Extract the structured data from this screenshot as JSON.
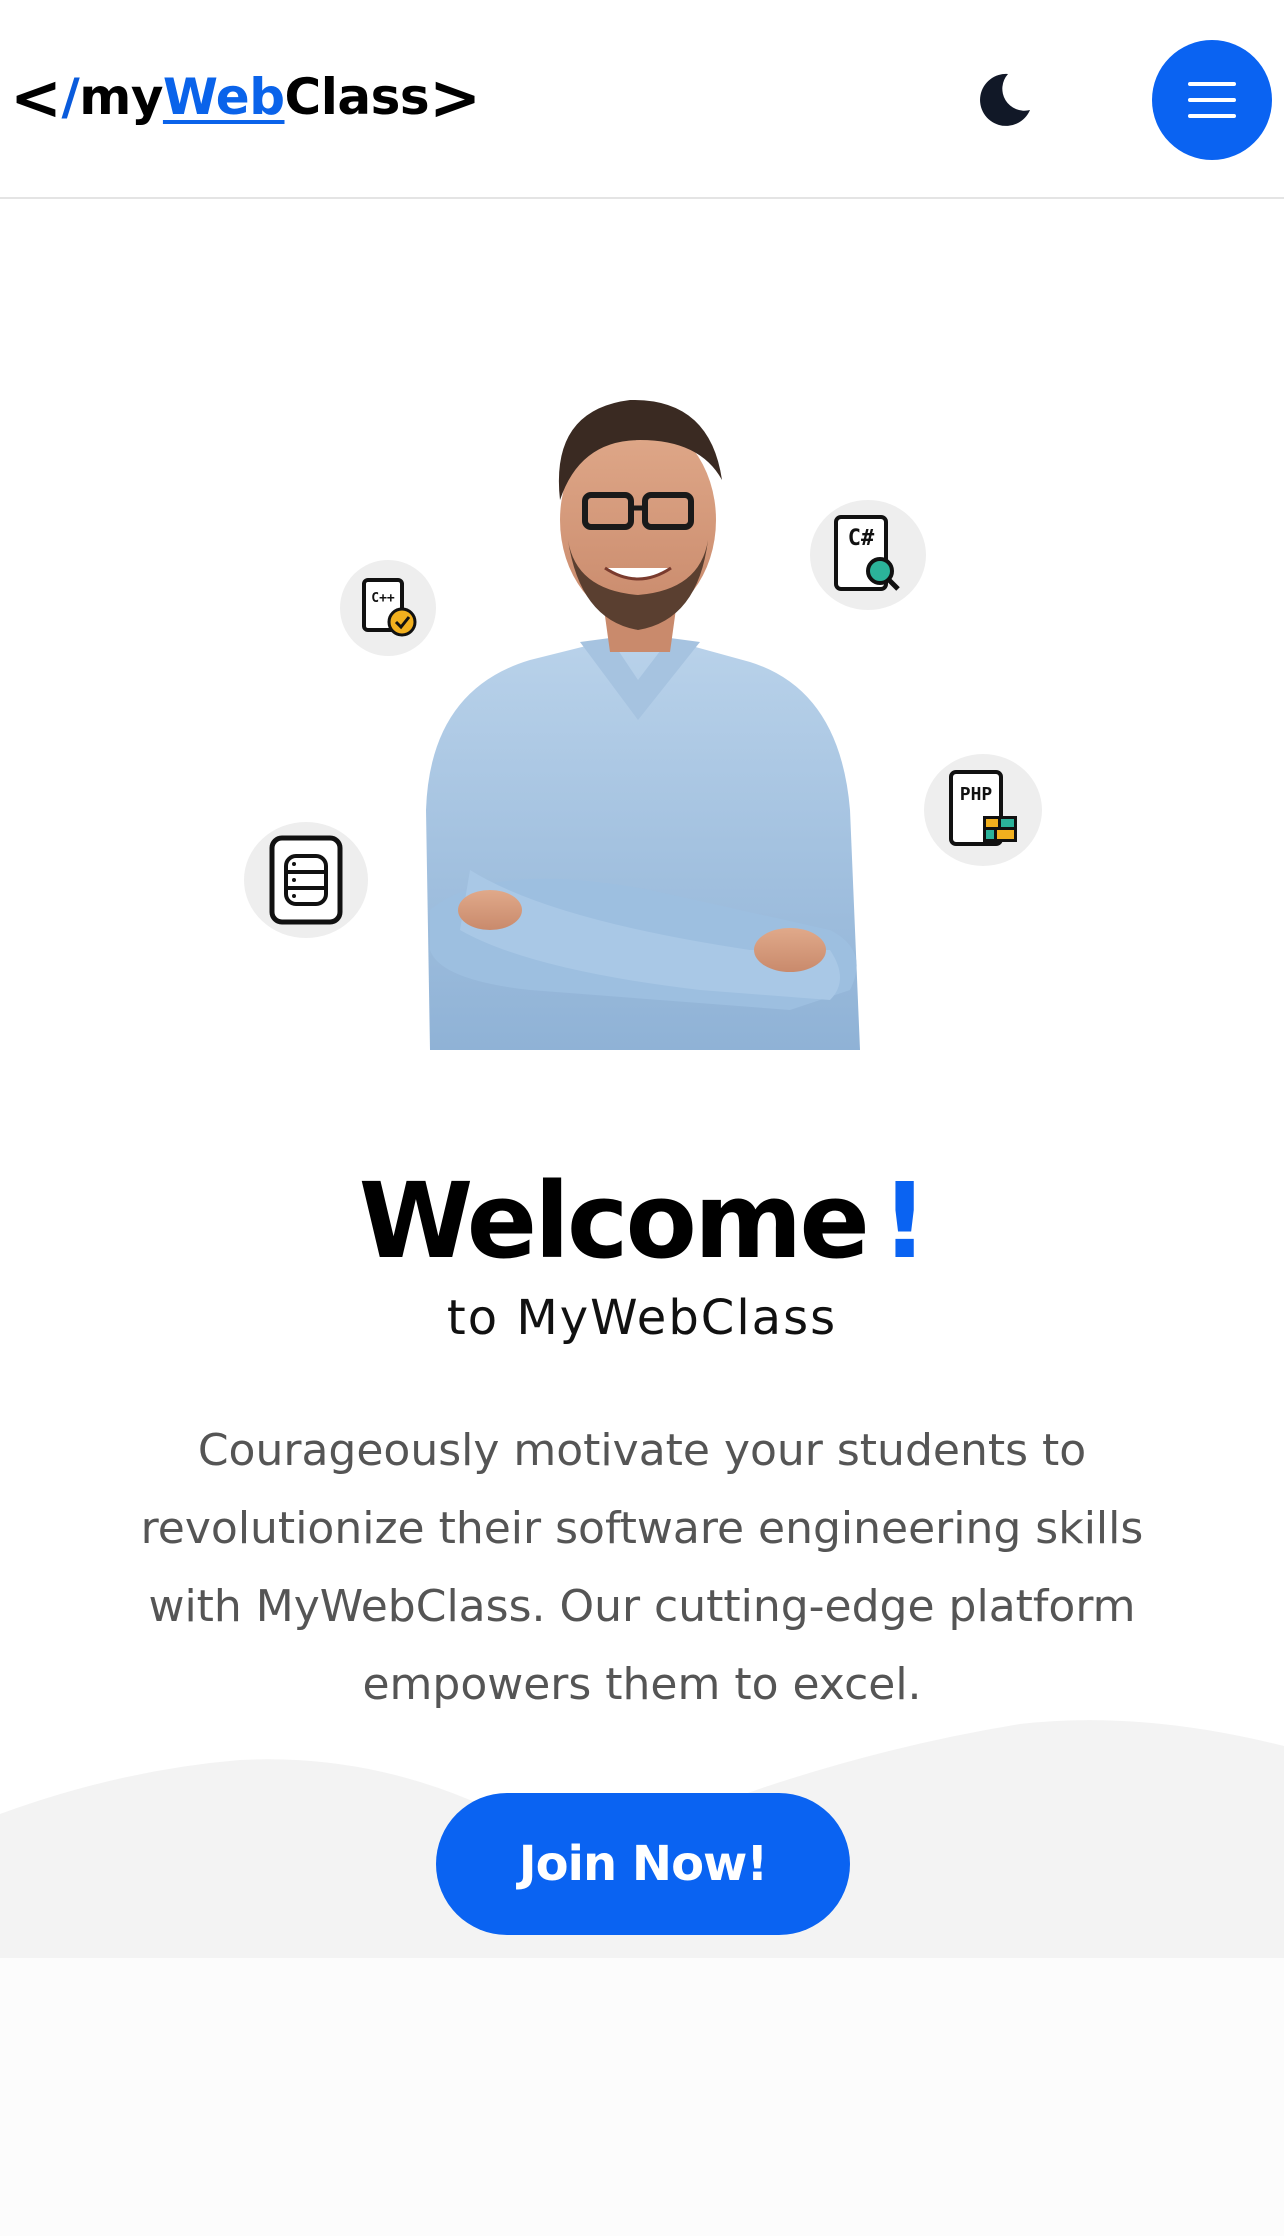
{
  "header": {
    "logo": {
      "open_bracket": "<",
      "slash": "/",
      "my": "my",
      "web": "Web",
      "cls": "Class",
      "close_bracket": ">"
    },
    "theme_toggle_icon": "moon-icon",
    "menu_icon": "hamburger-menu-icon"
  },
  "hero": {
    "badges": [
      {
        "label": "C++",
        "icon": "cpp-file-check-icon"
      },
      {
        "label": "C#",
        "icon": "csharp-file-search-icon"
      },
      {
        "label": "PHP",
        "icon": "php-file-icon"
      },
      {
        "label": "",
        "icon": "database-icon"
      }
    ],
    "image": "smiling-man-with-glasses-arms-crossed"
  },
  "main": {
    "welcome": "Welcome",
    "exclamation": "!",
    "subtitle": "to MyWebClass",
    "description": "Courageously motivate your students to revolutionize their software engineering skills with MyWebClass. Our cutting-edge platform empowers them to excel.",
    "cta_label": "Join Now!"
  },
  "colors": {
    "accent": "#0a63f2",
    "text": "#000000",
    "muted_text": "#555555",
    "wave": "#f3f3f3"
  }
}
